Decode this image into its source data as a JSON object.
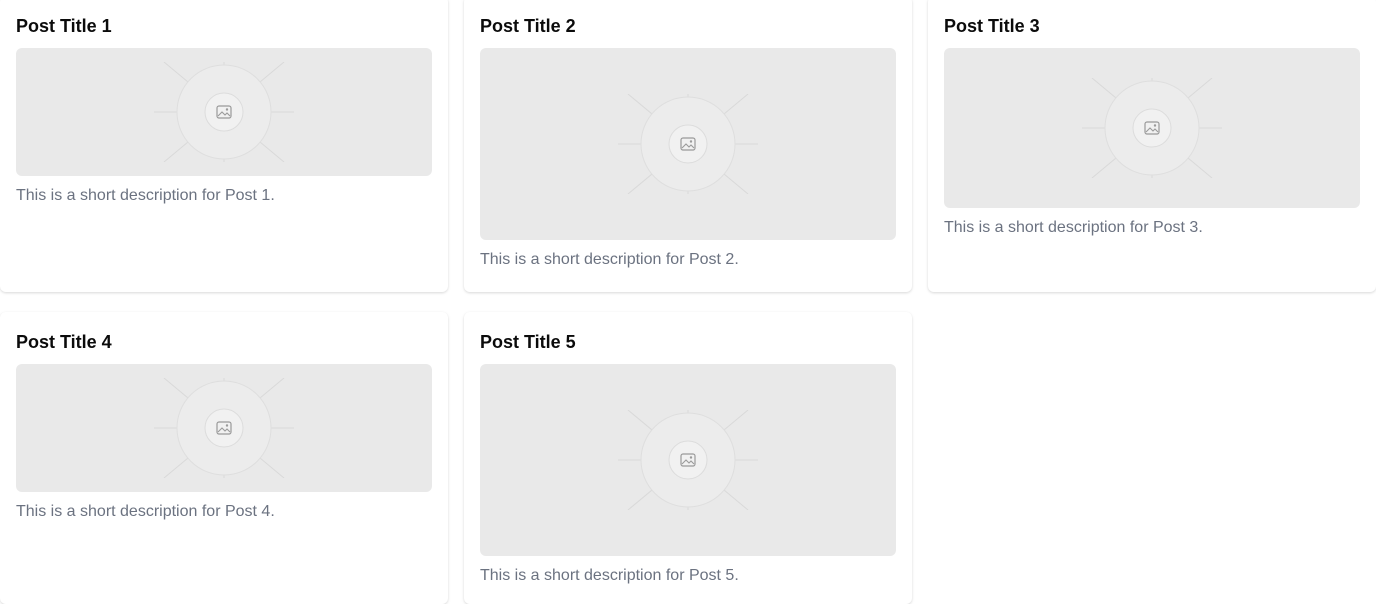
{
  "posts": [
    {
      "title": "Post Title 1",
      "description": "This is a short description for Post 1.",
      "image_icon": "image-placeholder-icon"
    },
    {
      "title": "Post Title 2",
      "description": "This is a short description for Post 2.",
      "image_icon": "image-placeholder-icon"
    },
    {
      "title": "Post Title 3",
      "description": "This is a short description for Post 3.",
      "image_icon": "image-placeholder-icon"
    },
    {
      "title": "Post Title 4",
      "description": "This is a short description for Post 4.",
      "image_icon": "image-placeholder-icon"
    },
    {
      "title": "Post Title 5",
      "description": "This is a short description for Post 5.",
      "image_icon": "image-placeholder-icon"
    }
  ],
  "colors": {
    "placeholder_bg": "#e9e9e9",
    "description_text": "#6b7280",
    "title_text": "#0b0b0b"
  }
}
